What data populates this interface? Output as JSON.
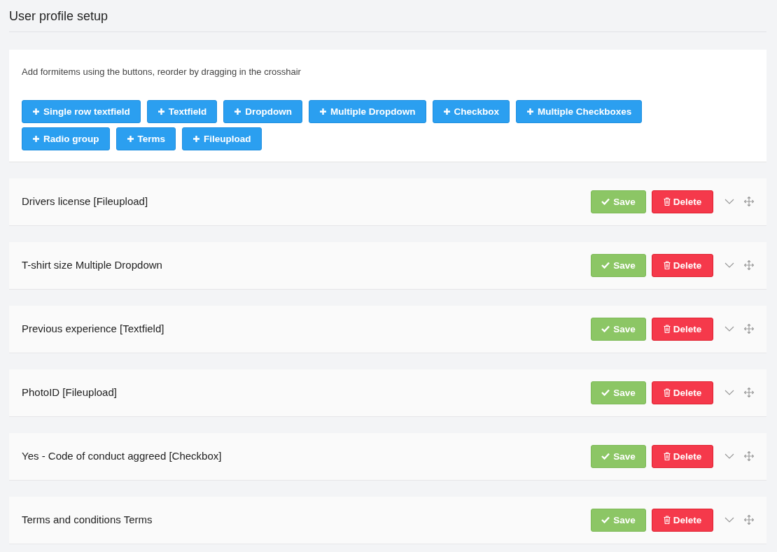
{
  "page_title": "User profile setup",
  "toolbar": {
    "hint": "Add formitems using the buttons, reorder by dragging in the crosshair",
    "add_buttons": [
      "Single row textfield",
      "Textfield",
      "Dropdown",
      "Multiple Dropdown",
      "Checkbox",
      "Multiple Checkboxes",
      "Radio group",
      "Terms",
      "Fileupload"
    ]
  },
  "form_items": [
    {
      "label": "Drivers license [Fileupload]",
      "save": "Save",
      "delete": "Delete"
    },
    {
      "label": "T-shirt size Multiple Dropdown",
      "save": "Save",
      "delete": "Delete"
    },
    {
      "label": "Previous experience [Textfield]",
      "save": "Save",
      "delete": "Delete"
    },
    {
      "label": "PhotoID [Fileupload]",
      "save": "Save",
      "delete": "Delete"
    },
    {
      "label": "Yes - Code of conduct aggreed [Checkbox]",
      "save": "Save",
      "delete": "Delete"
    },
    {
      "label": "Terms and conditions Terms",
      "save": "Save",
      "delete": "Delete"
    }
  ]
}
